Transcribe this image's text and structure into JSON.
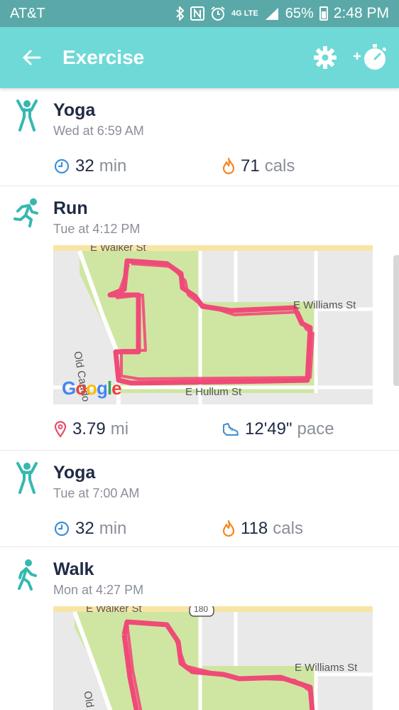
{
  "status_bar": {
    "carrier": "AT&T",
    "network": "4G LTE",
    "battery": "65%",
    "time": "2:48 PM"
  },
  "app_bar": {
    "title": "Exercise"
  },
  "activities": [
    {
      "name": "Yoga",
      "when": "Wed at 6:59 AM",
      "duration": "32",
      "duration_unit": "min",
      "calories": "71",
      "calories_unit": "cals"
    },
    {
      "name": "Run",
      "when": "Tue at 4:12 PM",
      "distance": "3.79",
      "distance_unit": "mi",
      "pace": "12'49\"",
      "pace_unit": "pace",
      "map": {
        "street_north": "E Walker St",
        "street_east": "E Williams St",
        "street_west": "Old Caddo",
        "street_south": "E Hullum St",
        "attribution": "Google"
      }
    },
    {
      "name": "Yoga",
      "when": "Tue at 7:00 AM",
      "duration": "32",
      "duration_unit": "min",
      "calories": "118",
      "calories_unit": "cals"
    },
    {
      "name": "Walk",
      "when": "Mon at 4:27 PM",
      "map": {
        "street_north": "E Walker St",
        "street_east": "E Williams St",
        "street_west": "Old C",
        "route_shield": "180"
      }
    }
  ],
  "colors": {
    "status_bar": "#5aa9a8",
    "app_bar": "#6fd9d8",
    "activity_icon": "#35b8b0",
    "route": "#f04a78",
    "clock_icon": "#3f8fd6",
    "flame_icon": "#f6871f",
    "pin_icon": "#e84a6b",
    "shoe_icon": "#3f8fd6",
    "park": "#cfe6a3"
  }
}
